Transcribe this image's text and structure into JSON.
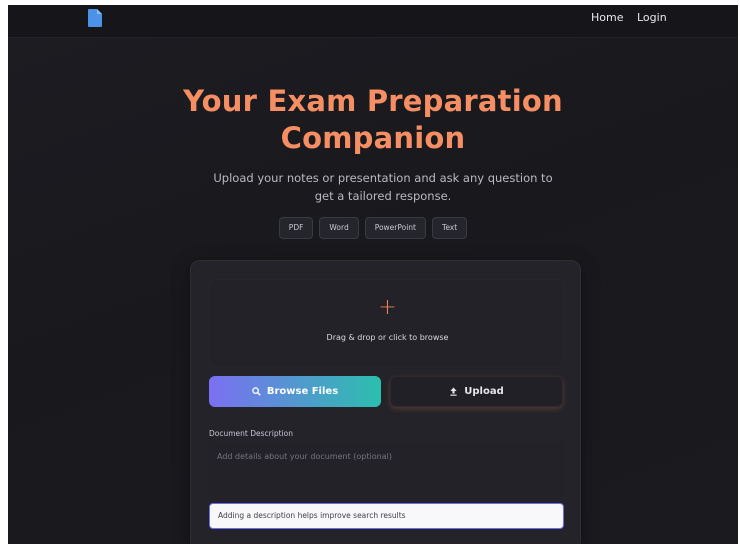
{
  "nav": {
    "logo_icon": "file-icon",
    "links": [
      "Home",
      "Login"
    ]
  },
  "hero": {
    "title_line1": "Your Exam Preparation",
    "title_line2": "Companion",
    "subtitle": "Upload your notes or presentation and ask any question to get a tailored response."
  },
  "formats": [
    "PDF",
    "Word",
    "PowerPoint",
    "Text"
  ],
  "upload": {
    "plus_icon": "plus-icon",
    "dropzone_text": "Drag & drop or click to browse",
    "browse_label": "Browse Files",
    "browse_icon": "search-icon",
    "upload_label": "Upload",
    "upload_icon": "upload-icon",
    "description_label": "Document Description",
    "description_placeholder": "Add details about your document (optional)",
    "hint": "Adding a description helps improve search results"
  },
  "colors": {
    "accent": "#f58e62",
    "gradient_start": "#7b6ff2",
    "gradient_end": "#2bbfae",
    "logo": "#4c93e8"
  }
}
